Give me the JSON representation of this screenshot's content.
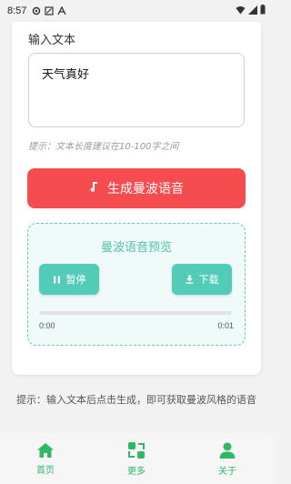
{
  "status_bar": {
    "time": "8:57"
  },
  "form": {
    "input_label": "输入文本",
    "input_value": "天气真好",
    "hint": "提示：文本长度建议在10-100字之间",
    "generate_button": "生成曼波语音"
  },
  "preview": {
    "title": "曼波语音预览",
    "pause_button": "暂停",
    "download_button": "下载",
    "progress": 0,
    "time_current": "0:00",
    "time_total": "0:01"
  },
  "tip": "提示：输入文本后点击生成，即可获取曼波风格的语音",
  "tabs": [
    {
      "label": "首页",
      "icon": "home-icon"
    },
    {
      "label": "更多",
      "icon": "more-icon"
    },
    {
      "label": "关于",
      "icon": "user-icon"
    }
  ],
  "colors": {
    "accent_red": "#f54d4f",
    "accent_teal": "#52cbb8",
    "tab_green": "#2fb86a"
  }
}
